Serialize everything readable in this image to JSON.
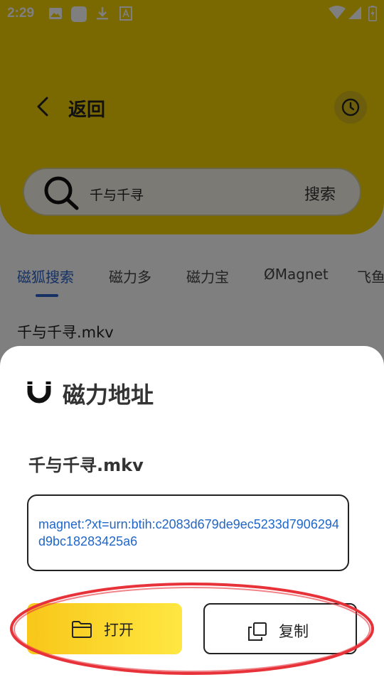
{
  "status_bar": {
    "time": "2:29"
  },
  "header": {
    "back_label": "返回"
  },
  "search": {
    "query": "千与千寻",
    "button_label": "搜索"
  },
  "tabs": [
    {
      "label": "磁狐搜索",
      "active": true
    },
    {
      "label": "磁力多",
      "active": false
    },
    {
      "label": "磁力宝",
      "active": false
    },
    {
      "label": "ØMagnet",
      "active": false
    },
    {
      "label": "飞鱼",
      "active": false
    }
  ],
  "results": [
    {
      "title": "千与千寻.mkv"
    }
  ],
  "sheet": {
    "title": "磁力地址",
    "file_name": "千与千寻.mkv",
    "magnet_link": "magnet:?xt=urn:btih:c2083d679de9ec5233d7906294d9bc18283425a6",
    "open_label": "打开",
    "copy_label": "复制"
  },
  "colors": {
    "header_yellow": "#f4d000",
    "accent_blue": "#2d63c8",
    "link_blue": "#1f66c9",
    "annotation_red": "#e8323a"
  }
}
